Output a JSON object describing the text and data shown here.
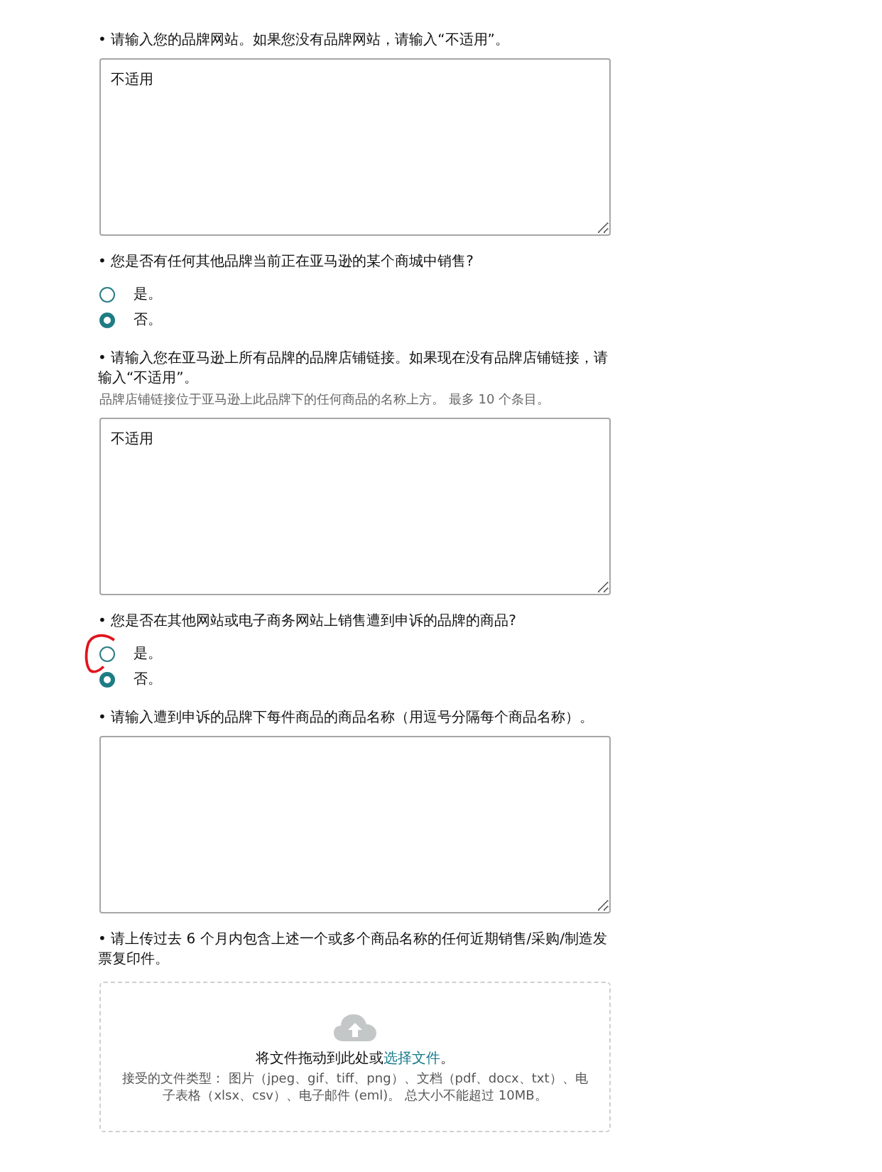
{
  "questions": [
    {
      "kind": "textarea",
      "label": "• 请输入您的品牌网站。如果您没有品牌网站，请输入“不适用”。",
      "value": "不适用"
    },
    {
      "kind": "radio",
      "label": "• 您是否有任何其他品牌当前正在亚马逊的某个商城中销售?",
      "options": [
        {
          "label": "是。",
          "selected": false
        },
        {
          "label": "否。",
          "selected": true
        }
      ]
    },
    {
      "kind": "textarea",
      "label": "• 请输入您在亚马逊上所有品牌的品牌店铺链接。如果现在没有品牌店铺链接，请输入“不适用”。",
      "hint": "品牌店铺链接位于亚马逊上此品牌下的任何商品的名称上方。 最多 10 个条目。",
      "value": "不适用"
    },
    {
      "kind": "radio",
      "label": "• 您是否在其他网站或电子商务网站上销售遭到申诉的品牌的商品?",
      "options": [
        {
          "label": "是。",
          "selected": false,
          "circled": true
        },
        {
          "label": "否。",
          "selected": true
        }
      ]
    },
    {
      "kind": "textarea",
      "label": "• 请输入遭到申诉的品牌下每件商品的商品名称（用逗号分隔每个商品名称）。"
    },
    {
      "kind": "upload",
      "label": "• 请上传过去 6 个月内包含上述一个或多个商品名称的任何近期销售/采购/制造发票复印件。",
      "prompt": "将文件拖动到此处或",
      "link": "选择文件",
      "prompt_end": "。",
      "note": "接受的文件类型： 图片（jpeg、gif、tiff、png）、文档（pdf、docx、txt）、电子表格（xlsx、csv）、电子邮件 (eml)。 总大小不能超过 10MB。"
    }
  ]
}
